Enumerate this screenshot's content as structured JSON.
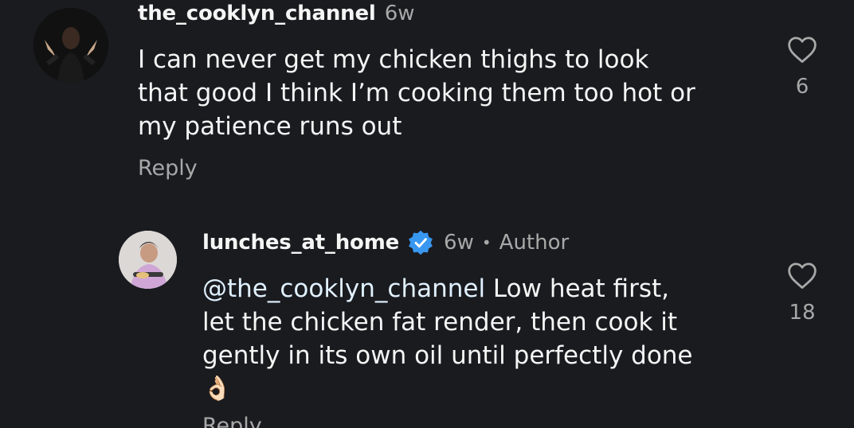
{
  "comments": [
    {
      "username": "the_cooklyn_channel",
      "time": "6w",
      "text": "I can never get my chicken thighs to look that good I think I’m cooking them too hot or my patience runs out",
      "line1": "I can never get my chicken thighs to look",
      "line2": "that good I think I’m cooking them too hot or",
      "line3": "my patience runs out",
      "reply_label": "Reply",
      "likes": "6"
    },
    {
      "username": "lunches_at_home",
      "verified": true,
      "time": "6w",
      "separator": "•",
      "author_tag": "Author",
      "mention": "@the_cooklyn_channel",
      "line1_rest": " Low heat first,",
      "line2": "let the chicken fat render, then cook it",
      "line3": "gently in its own oil until perfectly done",
      "emoji": "👌🏻",
      "reply_label": "Reply",
      "likes": "18"
    }
  ],
  "colors": {
    "background": "#1a1b1f",
    "text": "#f5f5f5",
    "muted": "#a8a8a8",
    "verified": "#3897f0",
    "mention": "#e0f1ff"
  },
  "icons": {
    "like": "heart-outline-icon",
    "verified": "verified-badge-icon"
  }
}
